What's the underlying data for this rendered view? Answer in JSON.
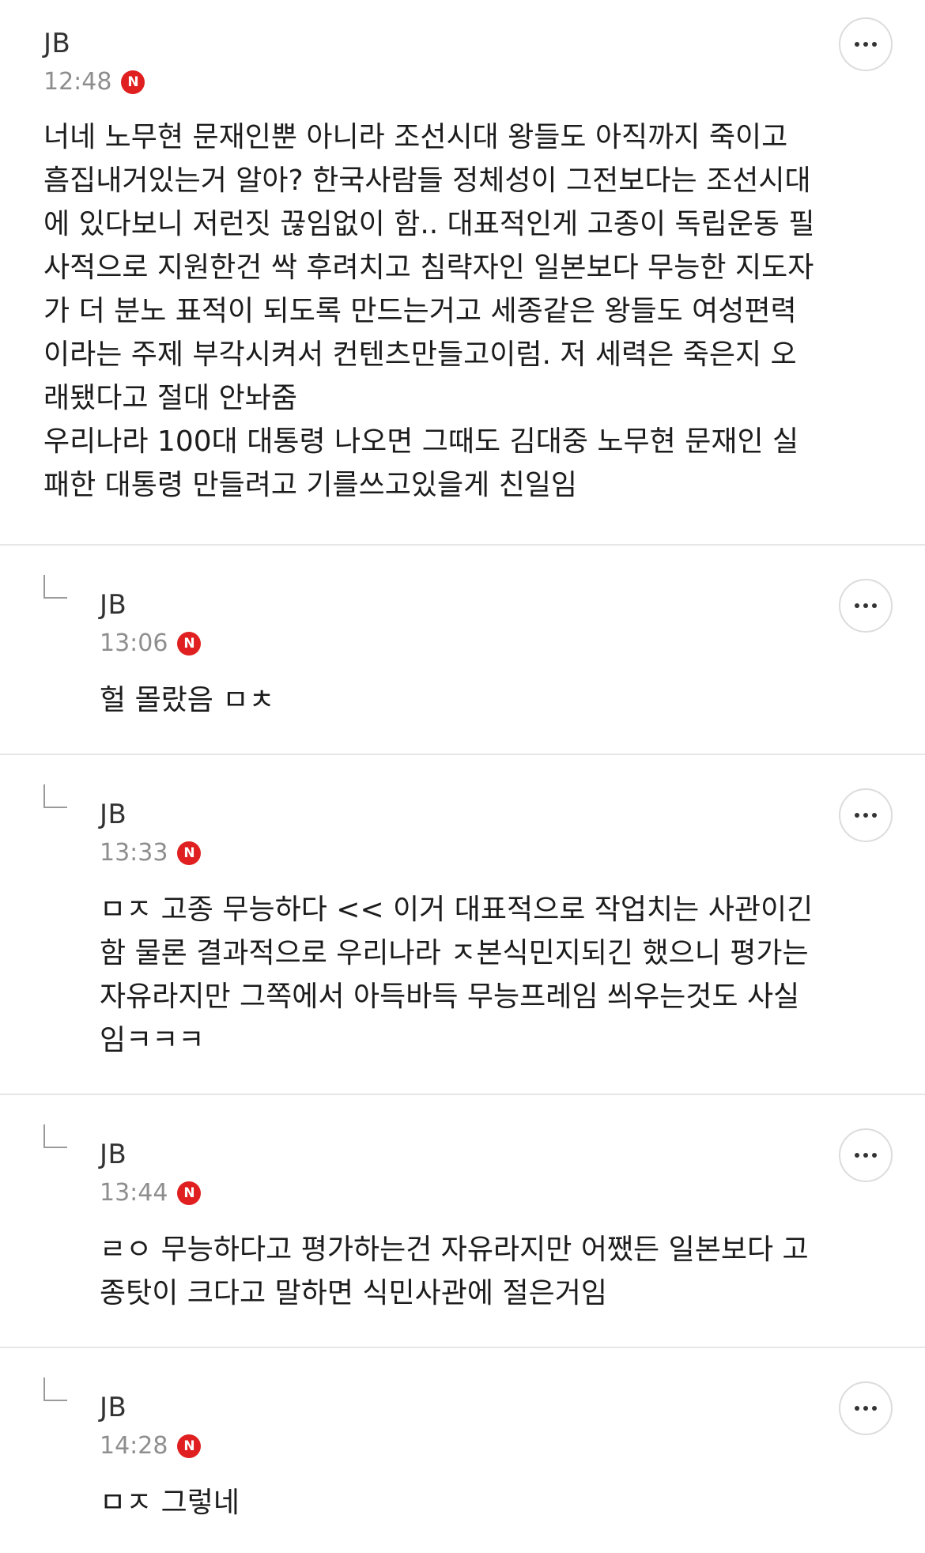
{
  "comments": [
    {
      "author": "JB",
      "time": "12:48",
      "badge": "N",
      "text": "너네 노무현 문재인뿐 아니라 조선시대 왕들도 아직까지 죽이고\n흠집내거있는거 알아? 한국사람들 정체성이 그전보다는 조선시대\n에 있다보니 저런짓 끊임없이 함.. 대표적인게 고종이 독립운동 필\n사적으로 지원한건 싹 후려치고 침략자인 일본보다 무능한 지도자\n가 더 분노 표적이 되도록 만드는거고 세종같은 왕들도 여성편력\n이라는 주제 부각시켜서 컨텐츠만들고이럼. 저 세력은 죽은지 오\n래됐다고 절대 안놔줌\n우리나라 100대 대통령 나오면 그때도 김대중 노무현 문재인 실\n패한 대통령 만들려고 기를쓰고있을게 친일임"
    },
    {
      "author": "JB",
      "time": "13:06",
      "badge": "N",
      "text": "헐 몰랐음 ㅁㅊ"
    },
    {
      "author": "JB",
      "time": "13:33",
      "badge": "N",
      "text": "ㅁㅈ 고종 무능하다 << 이거 대표적으로 작업치는 사관이긴\n함 물론 결과적으로 우리나라 ㅈ본식민지되긴 했으니 평가는\n자유라지만 그쪽에서 아득바득 무능프레임 씌우는것도 사실\n임ㅋㅋㅋ"
    },
    {
      "author": "JB",
      "time": "13:44",
      "badge": "N",
      "text": "ㄹㅇ 무능하다고 평가하는건 자유라지만 어쨌든 일본보다 고\n종탓이 크다고 말하면 식민사관에 절은거임"
    },
    {
      "author": "JB",
      "time": "14:28",
      "badge": "N",
      "text": "ㅁㅈ 그렇네"
    }
  ]
}
